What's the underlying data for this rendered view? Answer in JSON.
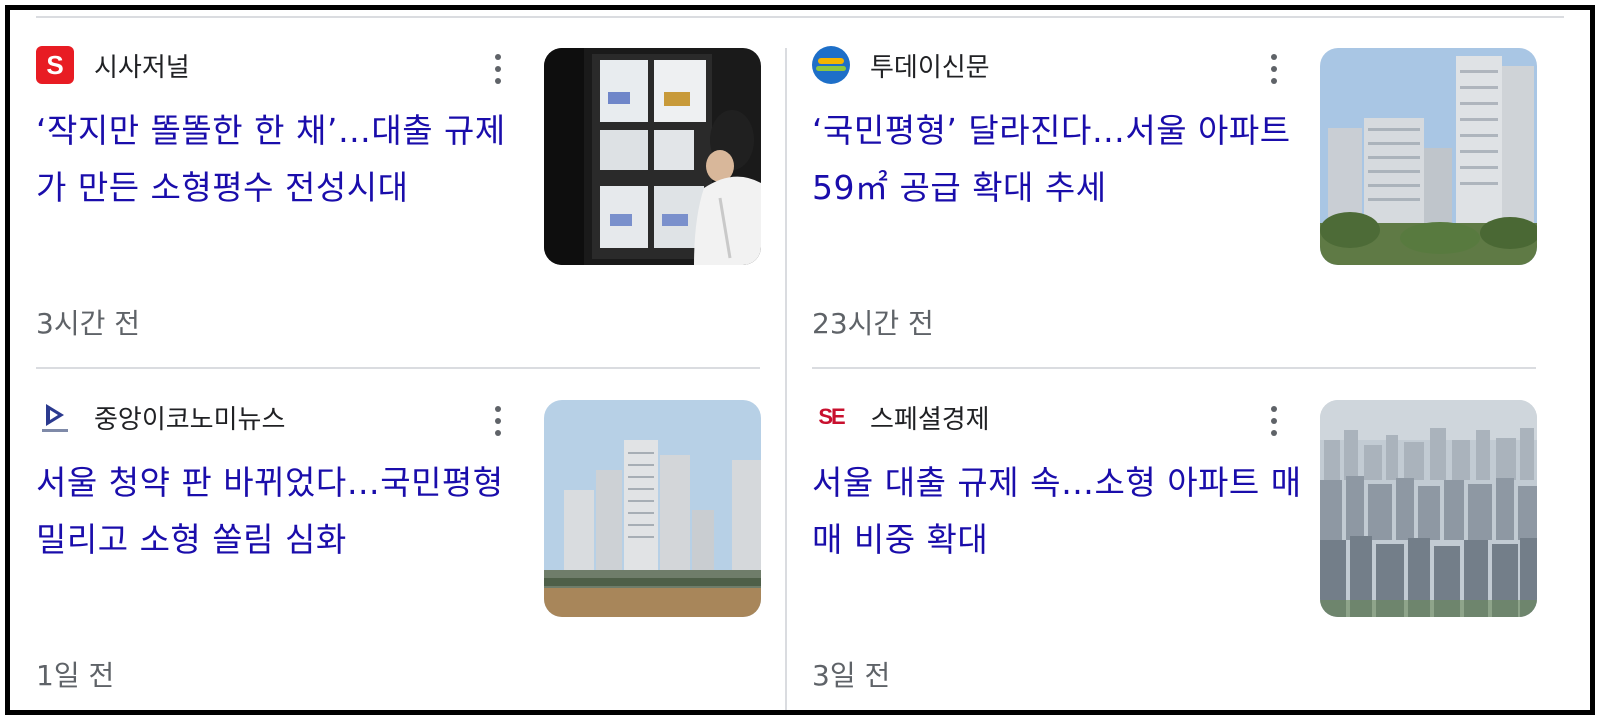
{
  "articles": [
    {
      "source": "시사저널",
      "logo_icon": "sisajournal-logo-icon",
      "logo_text": "S",
      "headline": "‘작지만 똘똘한 한 채’…대출 규제가 만든 소형평수 전성시대",
      "time": "3시간 전",
      "thumbnail": "real-estate-office-window-photo"
    },
    {
      "source": "투데이신문",
      "logo_icon": "todayshinmun-logo-icon",
      "headline": "‘국민평형’ 달라진다…서울 아파트 59㎡ 공급 확대 추세",
      "time": "23시간 전",
      "thumbnail": "apartment-towers-photo"
    },
    {
      "source": "중앙이코노미뉴스",
      "logo_icon": "joongang-economy-logo-icon",
      "headline": "서울 청약 판 바뀌었다…국민평형 밀리고 소형 쏠림 심화",
      "time": "1일 전",
      "thumbnail": "new-apartment-complex-photo"
    },
    {
      "source": "스페셜경제",
      "logo_icon": "special-economy-logo-icon",
      "logo_text": "SE",
      "headline": "서울 대출 규제 속…소형 아파트 매매 비중 확대",
      "time": "3일 전",
      "thumbnail": "dense-city-apartments-photo"
    }
  ],
  "colors": {
    "headline": "#1a0dab",
    "meta": "#5f6368",
    "divider": "#dadce0",
    "sisa_red": "#e81c23"
  }
}
